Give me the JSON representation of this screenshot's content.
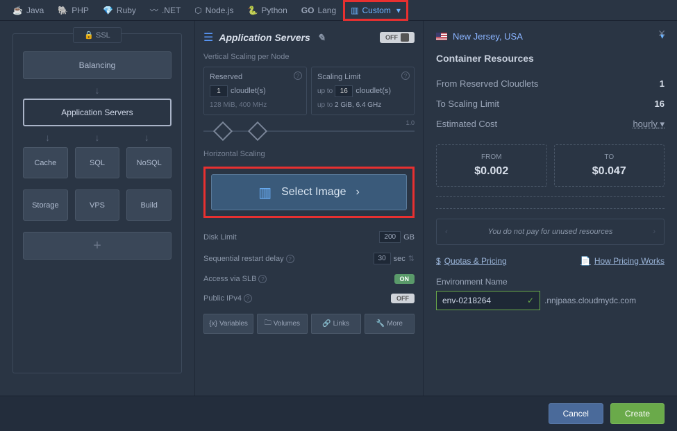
{
  "tabs": {
    "java": "Java",
    "php": "PHP",
    "ruby": "Ruby",
    "net": ".NET",
    "node": "Node.js",
    "python": "Python",
    "go": "Lang",
    "custom": "Custom"
  },
  "region": {
    "name": "New Jersey, USA"
  },
  "left": {
    "ssl": "SSL",
    "balancing": "Balancing",
    "app_servers": "Application Servers",
    "cache": "Cache",
    "sql": "SQL",
    "nosql": "NoSQL",
    "storage": "Storage",
    "vps": "VPS",
    "build": "Build"
  },
  "mid": {
    "title": "Application Servers",
    "off": "OFF",
    "vlabel": "Vertical Scaling per Node",
    "reserved": {
      "title": "Reserved",
      "val": "1",
      "unit": "cloudlet(s)",
      "spec": "128 MiB, 400 MHz"
    },
    "limit": {
      "title": "Scaling Limit",
      "upto": "up to",
      "val": "16",
      "unit": "cloudlet(s)",
      "spec_pre": "up to ",
      "spec": "2 GiB, 6.4 GHz"
    },
    "slider_max": "1.0",
    "hscaling": "Horizontal Scaling",
    "select_image": "Select Image",
    "disk": {
      "label": "Disk Limit",
      "val": "200",
      "unit": "GB"
    },
    "restart": {
      "label": "Sequential restart delay",
      "val": "30",
      "unit": "sec"
    },
    "slb": {
      "label": "Access via SLB",
      "state": "ON"
    },
    "ipv4": {
      "label": "Public IPv4",
      "state": "OFF"
    },
    "buttons": {
      "vars": "Variables",
      "vols": "Volumes",
      "links": "Links",
      "more": "More"
    }
  },
  "right": {
    "title": "Container Resources",
    "from_reserved": {
      "label": "From Reserved Cloudlets",
      "val": "1"
    },
    "to_limit": {
      "label": "To Scaling Limit",
      "val": "16"
    },
    "est": {
      "label": "Estimated Cost",
      "unit": "hourly"
    },
    "price_from": {
      "label": "FROM",
      "val": "$0.002"
    },
    "price_to": {
      "label": "TO",
      "val": "$0.047"
    },
    "nopay": "You do not pay for unused resources",
    "quotas": "Quotas & Pricing",
    "how": "How Pricing Works",
    "env_label": "Environment Name",
    "env_name": "env-0218264",
    "domain": ".nnjpaas.cloudmydc.com"
  },
  "footer": {
    "cancel": "Cancel",
    "create": "Create"
  }
}
